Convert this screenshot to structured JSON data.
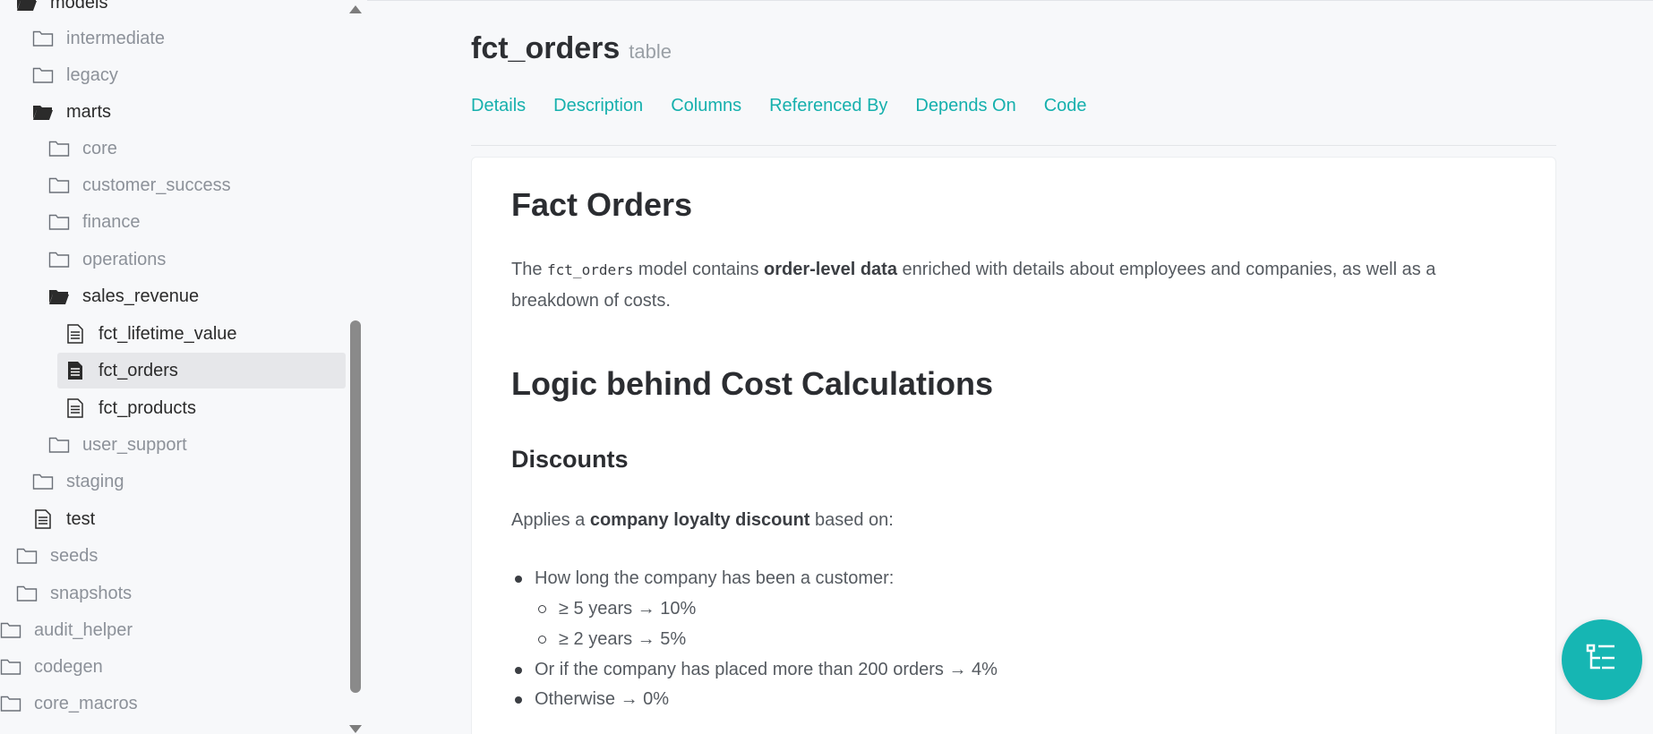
{
  "sidebar": {
    "items": [
      {
        "label": "models",
        "type": "folder-open"
      },
      {
        "label": "intermediate",
        "type": "folder"
      },
      {
        "label": "legacy",
        "type": "folder"
      },
      {
        "label": "marts",
        "type": "folder-open"
      },
      {
        "label": "core",
        "type": "folder"
      },
      {
        "label": "customer_success",
        "type": "folder"
      },
      {
        "label": "finance",
        "type": "folder"
      },
      {
        "label": "operations",
        "type": "folder"
      },
      {
        "label": "sales_revenue",
        "type": "folder-open"
      },
      {
        "label": "fct_lifetime_value",
        "type": "file"
      },
      {
        "label": "fct_orders",
        "type": "file",
        "selected": true
      },
      {
        "label": "fct_products",
        "type": "file"
      },
      {
        "label": "user_support",
        "type": "folder"
      },
      {
        "label": "staging",
        "type": "folder"
      },
      {
        "label": "test",
        "type": "file"
      },
      {
        "label": "seeds",
        "type": "folder"
      },
      {
        "label": "snapshots",
        "type": "folder"
      },
      {
        "label": "audit_helper",
        "type": "folder"
      },
      {
        "label": "codegen",
        "type": "folder"
      },
      {
        "label": "core_macros",
        "type": "folder"
      }
    ]
  },
  "header": {
    "title": "fct_orders",
    "subtitle": "table"
  },
  "tabs": [
    "Details",
    "Description",
    "Columns",
    "Referenced By",
    "Depends On",
    "Code"
  ],
  "content": {
    "h1": "Fact Orders",
    "intro_pre": "The ",
    "intro_code": "fct_orders",
    "intro_mid": " model contains ",
    "intro_bold": "order-level data",
    "intro_post": " enriched with details about employees and companies, as well as a breakdown of costs.",
    "h2": "Logic behind Cost Calculations",
    "h3": "Discounts",
    "applies_pre": "Applies a ",
    "applies_bold": "company loyalty discount",
    "applies_post": " based on:",
    "bullets": [
      "How long the company has been a customer:",
      "≥ 5 years → 10%",
      "≥ 2 years → 5%",
      "Or if the company has placed more than 200 orders → 4%",
      "Otherwise → 0%"
    ]
  },
  "colors": {
    "accent": "#16b0ad",
    "fab": "#16b6b3",
    "selected_bg": "#e6e7ea"
  },
  "icons": {
    "fab": "lineage-tree-icon"
  }
}
